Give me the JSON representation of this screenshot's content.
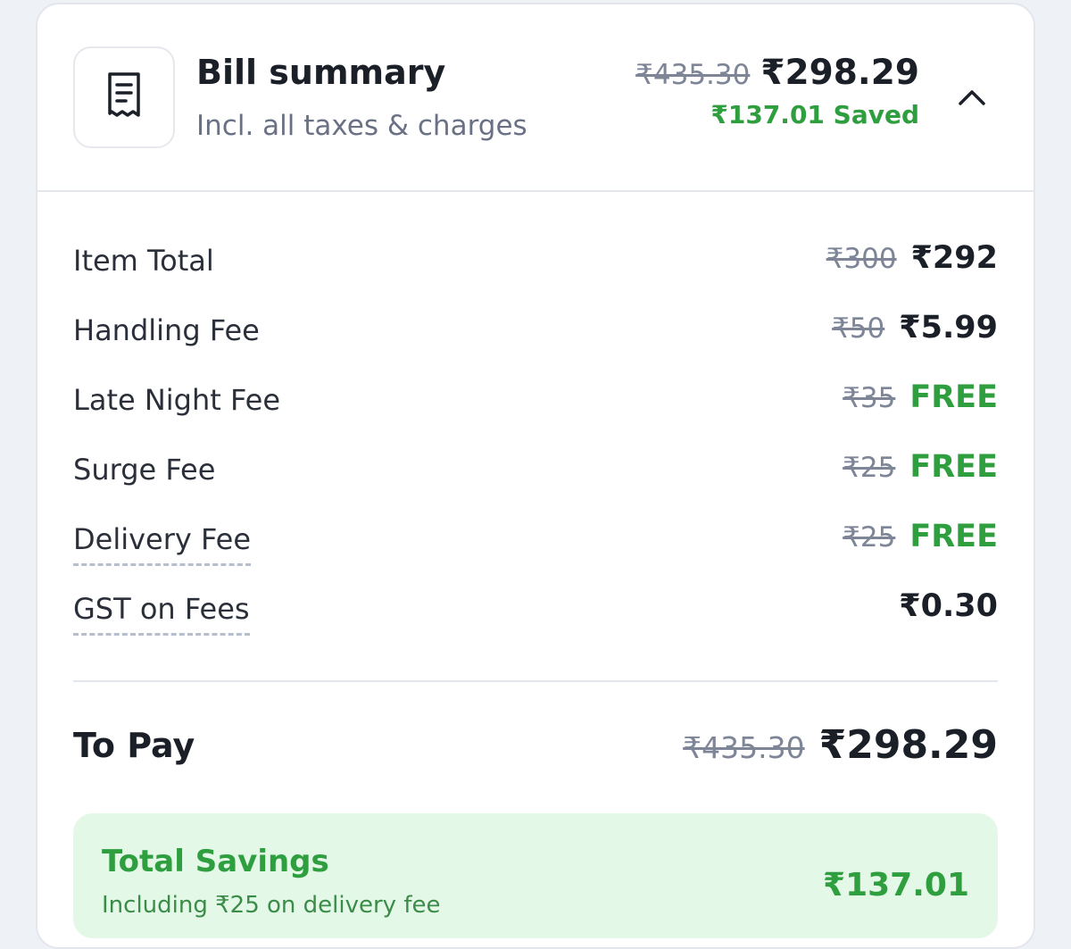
{
  "header": {
    "title": "Bill summary",
    "subtitle": "Incl. all taxes & charges",
    "original_total": "₹435.30",
    "total": "₹298.29",
    "saved": "₹137.01 Saved",
    "collapse_icon": "chevron-up-icon",
    "receipt_icon": "receipt-icon"
  },
  "rows": [
    {
      "label": "Item Total",
      "original": "₹300",
      "value": "₹292",
      "free": false,
      "dashed": false
    },
    {
      "label": "Handling Fee",
      "original": "₹50",
      "value": "₹5.99",
      "free": false,
      "dashed": false
    },
    {
      "label": "Late Night Fee",
      "original": "₹35",
      "value": "FREE",
      "free": true,
      "dashed": false
    },
    {
      "label": "Surge Fee",
      "original": "₹25",
      "value": "FREE",
      "free": true,
      "dashed": false
    },
    {
      "label": "Delivery Fee",
      "original": "₹25",
      "value": "FREE",
      "free": true,
      "dashed": true
    },
    {
      "label": "GST on Fees",
      "original": "",
      "value": "₹0.30",
      "free": false,
      "dashed": true
    }
  ],
  "to_pay": {
    "label": "To Pay",
    "original": "₹435.30",
    "value": "₹298.29"
  },
  "savings": {
    "title": "Total Savings",
    "subtitle": "Including ₹25 on delivery fee",
    "value": "₹137.01"
  },
  "colors": {
    "accent_green": "#2e9e3f",
    "savings_bg": "#e4f8e8",
    "muted_text": "#7d8597"
  }
}
